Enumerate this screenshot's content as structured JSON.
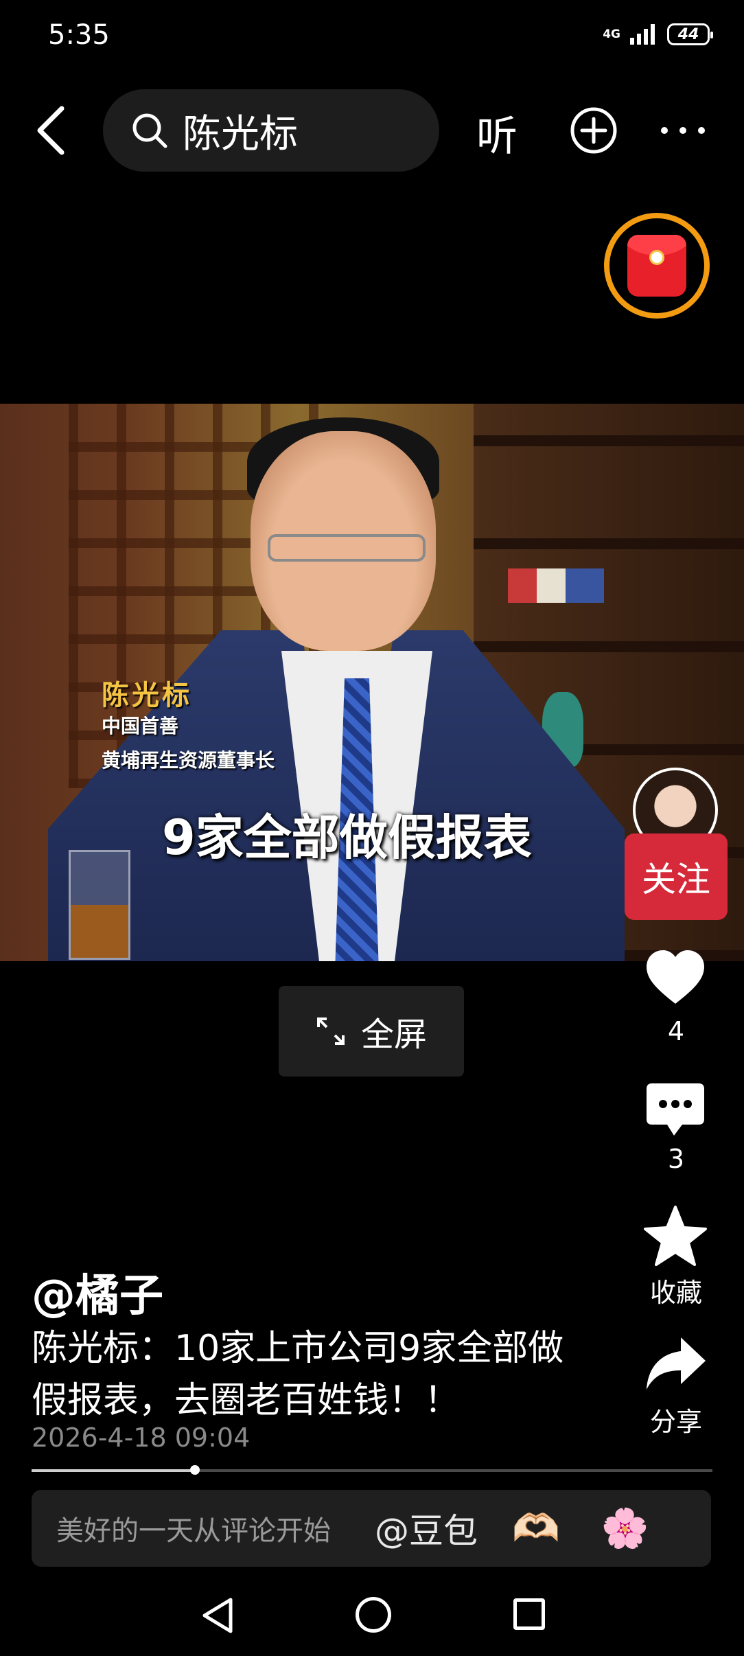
{
  "status_bar": {
    "time": "5:35",
    "network": "4G",
    "battery": "44"
  },
  "top_bar": {
    "search_query": "陈光标",
    "listen_label": "听"
  },
  "video": {
    "caption_name": "陈光标",
    "caption_title1": "中国首善",
    "caption_title2": "黄埔再生资源董事长",
    "caption_main": "9家全部做假报表",
    "fullscreen_label": "全屏"
  },
  "right_rail": {
    "follow_label": "关注",
    "like_count": "4",
    "comment_count": "3",
    "favorite_label": "收藏",
    "share_label": "分享"
  },
  "post": {
    "author": "@橘子",
    "text": "陈光标：10家上市公司9家全部做假报表，去圈老百姓钱！！",
    "date": "2026-4-18 09:04",
    "progress": 0.24
  },
  "comment_bar": {
    "placeholder": "美好的一天从评论开始",
    "mention": "@豆包",
    "emoji_1": "🫶🏻",
    "emoji_2": "🌸"
  },
  "colors": {
    "follow_red": "#d62a3a",
    "envelope_ring": "#f39c12",
    "caption_gold": "#f5c443"
  }
}
